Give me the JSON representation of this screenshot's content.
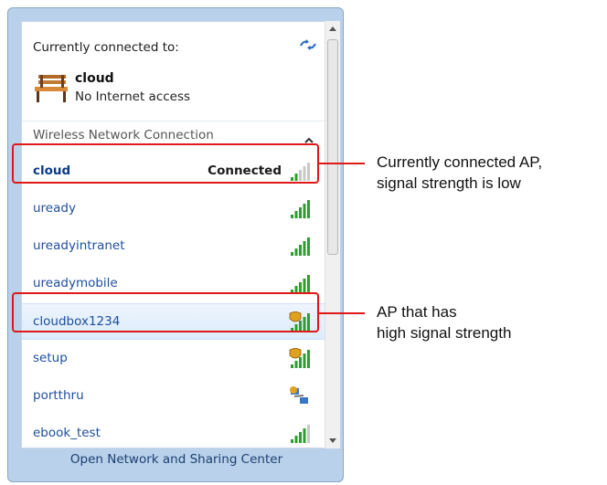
{
  "flyout": {
    "currently_connected_label": "Currently connected to:",
    "current_network": {
      "name": "cloud",
      "status": "No Internet access"
    },
    "section_title": "Wireless Network Connection",
    "networks": [
      {
        "name": "cloud",
        "status": "Connected",
        "signal_bars": 2,
        "secured_shield": false
      },
      {
        "name": "uready",
        "status": "",
        "signal_bars": 5,
        "secured_shield": false
      },
      {
        "name": "ureadyintranet",
        "status": "",
        "signal_bars": 5,
        "secured_shield": false
      },
      {
        "name": "ureadymobile",
        "status": "",
        "signal_bars": 5,
        "secured_shield": false
      },
      {
        "name": "cloudbox1234",
        "status": "",
        "signal_bars": 5,
        "secured_shield": true
      },
      {
        "name": "setup",
        "status": "",
        "signal_bars": 5,
        "secured_shield": true
      },
      {
        "name": "portthru",
        "status": "",
        "signal_bars": 0,
        "secured_shield": true
      },
      {
        "name": "ebook_test",
        "status": "",
        "signal_bars": 4,
        "secured_shield": false
      }
    ],
    "footer_link": "Open Network and Sharing Center"
  },
  "annotations": {
    "note1_line1": "Currently connected AP,",
    "note1_line2": "signal strength is low",
    "note2_line1": "AP that has",
    "note2_line2": "high signal strength"
  },
  "colors": {
    "highlight": "#e01818",
    "frame": "#b9d1ea",
    "signal_green": "#2e9e2e"
  },
  "icons": [
    "refresh-icon",
    "bench-icon",
    "collapse-chevron-icon",
    "signal-bars-icon",
    "shield-icon",
    "network-adhoc-icon"
  ]
}
